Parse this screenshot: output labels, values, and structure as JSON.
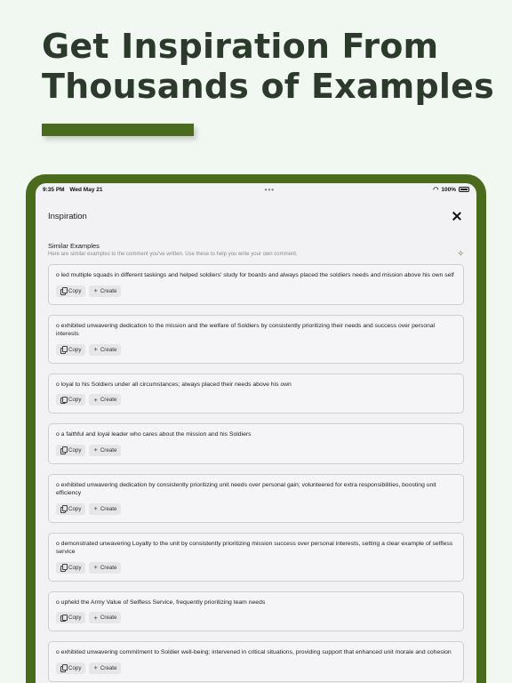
{
  "headline": {
    "line1": "Get Inspiration From",
    "line2": "Thousands of Examples"
  },
  "colors": {
    "background": "#f1f7f1",
    "accent": "#4a6b1c",
    "headline_text": "#2c3a2c"
  },
  "statusbar": {
    "time": "9:35 PM",
    "date": "Wed May 21",
    "dots": "•••",
    "battery": "100%"
  },
  "sheet": {
    "title": "Inspiration"
  },
  "section": {
    "title": "Similar Examples",
    "subtitle": "Here are similar examples to the comment you've written. Use these to help you write your own comment."
  },
  "actions": {
    "copy_label": "Copy",
    "create_label": "Create"
  },
  "examples": [
    {
      "text": "o led multiple squads in different taskings and helped soldiers' study for boards and always placed the soldiers needs and mission above his own self"
    },
    {
      "text": "o exhibited unwavering dedication to the mission and the welfare of Soldiers by consistently prioritizing their needs and success over personal interests"
    },
    {
      "text": "o loyal to his Soldiers under all circumstances; always placed their needs above his own"
    },
    {
      "text": "o a faithful and loyal leader who cares about the mission and his Soldiers"
    },
    {
      "text": "o exhibited unwavering dedication by consistently prioritizing unit needs over personal gain; volunteered for extra responsibilities, boosting unit efficiency"
    },
    {
      "text": "o demonstrated unwavering Loyalty to the unit by consistently prioritizing mission success over personal interests, setting a clear example of selfless service"
    },
    {
      "text": "o upheld the Army Value of Selfless Service, frequently prioritizing team needs"
    },
    {
      "text": "o exhibited unwavering commitment to Soldier well-being; intervened in  critical situations, providing support that enhanced unit morale and cohesion"
    }
  ]
}
